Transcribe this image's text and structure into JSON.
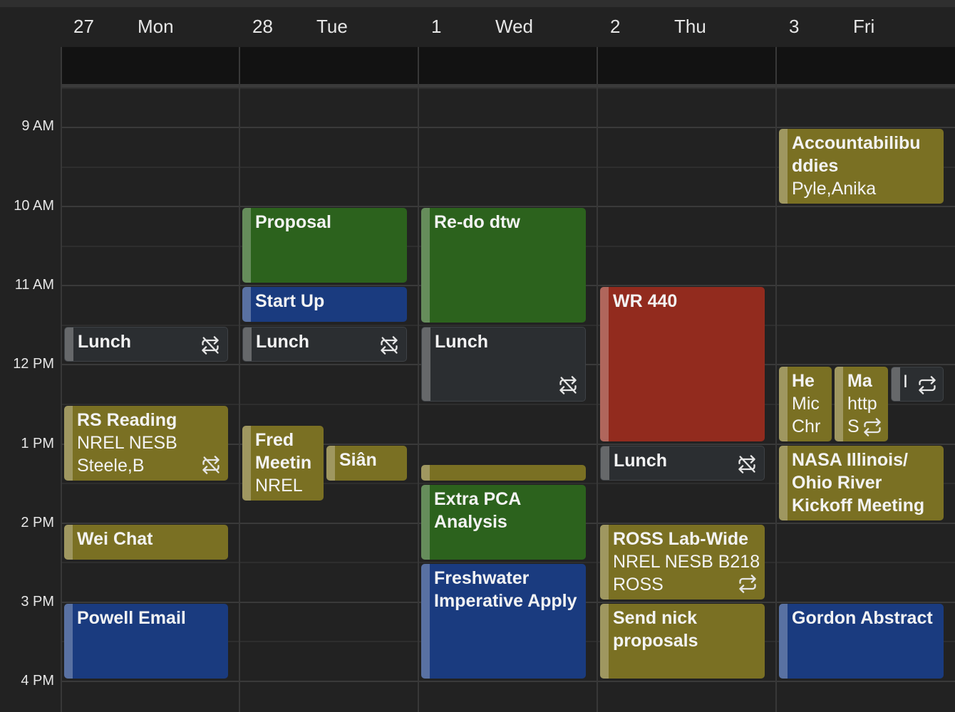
{
  "days": [
    {
      "num": "27",
      "name": "Mon"
    },
    {
      "num": "28",
      "name": "Tue"
    },
    {
      "num": "1",
      "name": "Wed"
    },
    {
      "num": "2",
      "name": "Thu"
    },
    {
      "num": "3",
      "name": "Fri"
    }
  ],
  "time_labels": [
    "9 AM",
    "10 AM",
    "11 AM",
    "12 PM",
    "1 PM",
    "2 PM",
    "3 PM",
    "4 PM"
  ],
  "events": {
    "mon_lunch": {
      "title": "Lunch",
      "icon": "recurrence-off-icon"
    },
    "mon_rs_reading": {
      "title": "RS Reading",
      "line1": "NREL NESB",
      "line2": "Steele,B",
      "icon": "recurrence-off-icon"
    },
    "mon_wei_chat": {
      "title": "Wei Chat"
    },
    "mon_powell_email": {
      "title": "Powell Email"
    },
    "tue_proposal": {
      "title": "Proposal"
    },
    "tue_start_up": {
      "title": "Start Up"
    },
    "tue_lunch": {
      "title": "Lunch",
      "icon": "recurrence-off-icon"
    },
    "tue_fred": {
      "title": "Fred Meetin",
      "line1": "NREL"
    },
    "tue_sian": {
      "title": "Siân"
    },
    "wed_redo": {
      "title": "Re-do dtw"
    },
    "wed_lunch": {
      "title": "Lunch",
      "icon": "recurrence-off-icon"
    },
    "wed_small": {
      "title": ""
    },
    "wed_extra_pca": {
      "title": "Extra PCA Analysis"
    },
    "wed_freshwater": {
      "title": "Freshwater Imperative Apply"
    },
    "thu_wr440": {
      "title": "WR 440"
    },
    "thu_lunch": {
      "title": "Lunch",
      "icon": "recurrence-off-icon"
    },
    "thu_ross": {
      "title": "ROSS Lab-Wide",
      "line1": "NREL NESB B218",
      "line2": "ROSS",
      "icon": "recurrence-icon"
    },
    "thu_send_nick": {
      "title": "Send nick proposals"
    },
    "fri_accountabilibuddies": {
      "title": "Accountabilibu ddies",
      "line1": "Pyle,Anika"
    },
    "fri_he": {
      "title": "He",
      "line1": "Mic",
      "line2": "Chr"
    },
    "fri_ma": {
      "title": "Ma",
      "line1": "http",
      "line2": "S",
      "icon": "recurrence-icon"
    },
    "fri_third": {
      "title": "I",
      "icon": "recurrence-icon"
    },
    "fri_nasa": {
      "title": "NASA Illinois/ Ohio River Kickoff Meeting"
    },
    "fri_gordon": {
      "title": "Gordon Abstract"
    }
  },
  "colors": {
    "green": "#2c621d",
    "blue": "#1a3b7f",
    "olive": "#7a7023",
    "grey": "#2b2e31",
    "red": "#922b1e",
    "background": "#222222",
    "allday_background": "#121212"
  }
}
